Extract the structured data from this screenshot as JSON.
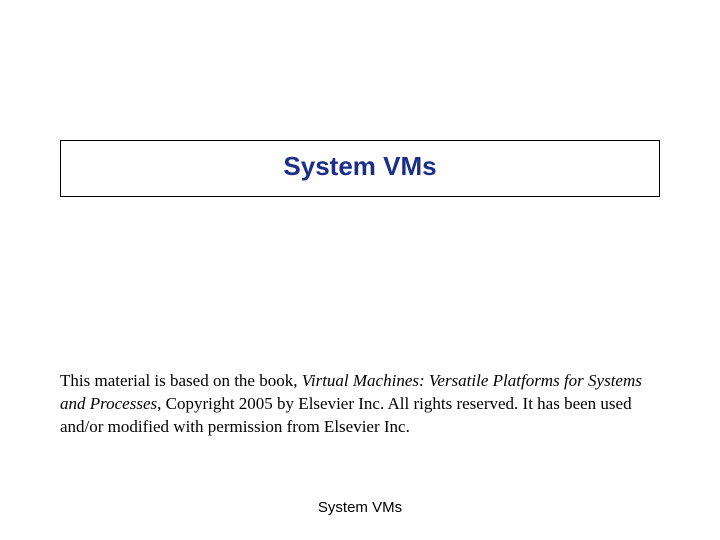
{
  "title": "System VMs",
  "body": {
    "prefix": "This material is based on the book, ",
    "book_title": "Virtual Machines: Versatile Platforms for Systems and Processes",
    "suffix": ", Copyright 2005 by Elsevier Inc. All rights reserved. It has been used and/or modified with permission from Elsevier Inc."
  },
  "footer": "System VMs"
}
